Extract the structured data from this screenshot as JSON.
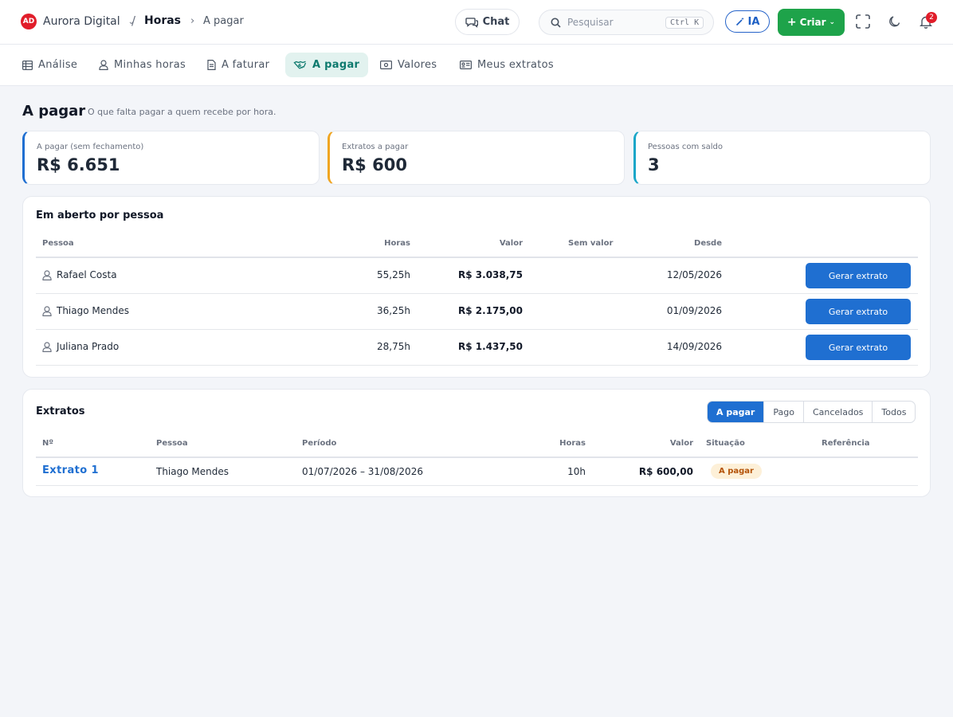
{
  "brand": {
    "logo": "AD",
    "name": "Aurora Digital"
  },
  "breadcrumb": {
    "separator": "/",
    "section": "Horas",
    "arrow": "›",
    "current": "A pagar"
  },
  "header": {
    "chat_label": "Chat",
    "search_placeholder": "Pesquisar",
    "search_shortcut": "Ctrl K",
    "ia_label": "IA",
    "create_label": "Criar",
    "notifications_count": "2"
  },
  "nav": {
    "tabs": [
      {
        "label": "Análise",
        "icon": "table-icon"
      },
      {
        "label": "Minhas horas",
        "icon": "user-icon"
      },
      {
        "label": "A faturar",
        "icon": "document-icon"
      },
      {
        "label": "A pagar",
        "icon": "handshake-icon"
      },
      {
        "label": "Valores",
        "icon": "cash-icon"
      },
      {
        "label": "Meus extratos",
        "icon": "id-card-icon"
      }
    ]
  },
  "page": {
    "title": "A pagar",
    "subtitle": "O que falta pagar a quem recebe por hora."
  },
  "stats": [
    {
      "label": "A pagar (sem fechamento)",
      "value": "R$ 6.651",
      "accent": "#1f6fd1"
    },
    {
      "label": "Extratos a pagar",
      "value": "R$ 600",
      "accent": "#f0a521"
    },
    {
      "label": "Pessoas com saldo",
      "value": "3",
      "accent": "#1aa6c8"
    }
  ],
  "open": {
    "title": "Em aberto por pessoa",
    "columns": {
      "person": "Pessoa",
      "hours": "Horas",
      "value": "Valor",
      "no_value": "Sem valor",
      "since": "Desde"
    },
    "rows": [
      {
        "person": "Rafael Costa",
        "hours": "55,25h",
        "value": "R$ 3.038,75",
        "since": "12/05/2026",
        "action": "Gerar extrato"
      },
      {
        "person": "Thiago Mendes",
        "hours": "36,25h",
        "value": "R$ 2.175,00",
        "since": "01/09/2026",
        "action": "Gerar extrato"
      },
      {
        "person": "Juliana Prado",
        "hours": "28,75h",
        "value": "R$ 1.437,50",
        "since": "14/09/2026",
        "action": "Gerar extrato"
      }
    ]
  },
  "statements": {
    "title": "Extratos",
    "filters": [
      "A pagar",
      "Pago",
      "Cancelados",
      "Todos"
    ],
    "active_filter": "A pagar",
    "columns": {
      "number": "Nº",
      "person": "Pessoa",
      "period": "Período",
      "hours": "Horas",
      "value": "Valor",
      "status": "Situação",
      "reference": "Referência"
    },
    "rows": [
      {
        "number": "Extrato 1",
        "person": "Thiago Mendes",
        "period": "01/07/2026 – 31/08/2026",
        "hours": "10h",
        "value": "R$ 600,00",
        "status": "A pagar",
        "reference": ""
      }
    ]
  }
}
